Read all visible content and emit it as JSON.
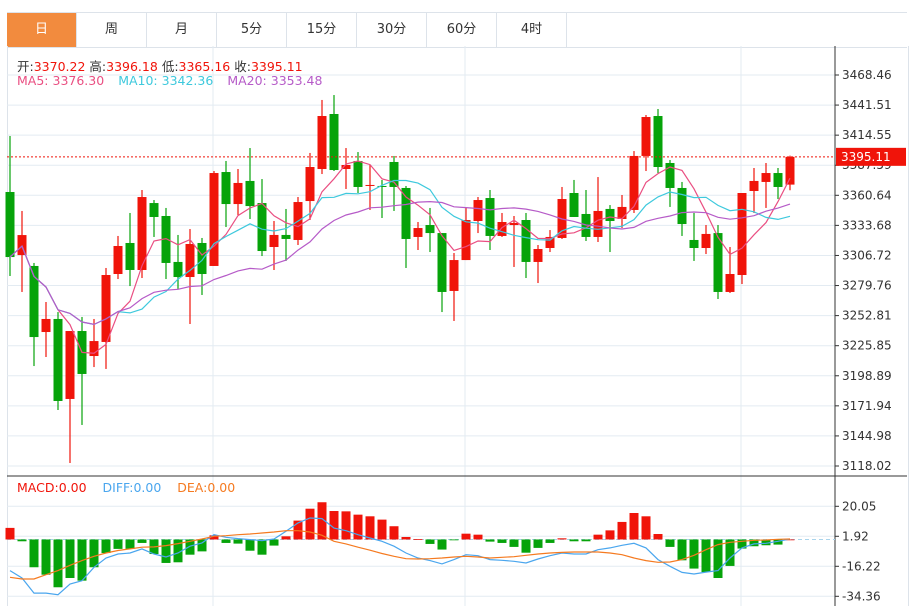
{
  "tabs": [
    {
      "label": "日",
      "active": true
    },
    {
      "label": "周"
    },
    {
      "label": "月"
    },
    {
      "label": "5分"
    },
    {
      "label": "15分"
    },
    {
      "label": "30分"
    },
    {
      "label": "60分"
    },
    {
      "label": "4时"
    }
  ],
  "ohlc_info": {
    "open_label": "开:",
    "open": "3370.22",
    "high_label": "高:",
    "high": "3396.18",
    "low_label": "低:",
    "low": "3365.16",
    "close_label": "收:",
    "close": "3395.11"
  },
  "ma_info": {
    "ma5_label": "MA5:",
    "ma5": "3376.30",
    "ma10_label": "MA10:",
    "ma10": "3342.36",
    "ma20_label": "MA20:",
    "ma20": "3353.48"
  },
  "macd_info": {
    "macd_label": "MACD:",
    "macd": "0.00",
    "diff_label": "DIFF:",
    "diff": "0.00",
    "dea_label": "DEA:",
    "dea": "0.00"
  },
  "current_price_label": "3395.11",
  "colors": {
    "up": "#f0140a",
    "down": "#06a30a",
    "ma5": "#ea4f82",
    "ma10": "#3ec9dd",
    "ma20": "#b65bc8",
    "diff": "#4aa6ee",
    "dea": "#f57a20",
    "active_tab": "#f28b3e"
  },
  "chart_data": [
    {
      "type": "candlestick",
      "title": "",
      "ylim": [
        3118.02,
        3468.46
      ],
      "y_ticks": [
        "3468.46",
        "3441.51",
        "3414.55",
        "3387.59",
        "3360.64",
        "3333.68",
        "3306.72",
        "3279.76",
        "3252.81",
        "3225.85",
        "3198.89",
        "3171.94",
        "3144.98",
        "3118.02"
      ],
      "grid": true,
      "current_price": 3395.11,
      "overlays": [
        "MA5",
        "MA10",
        "MA20"
      ],
      "ohlc": [
        [
          3363.6,
          3413.8,
          3288.3,
          3305.3
        ],
        [
          3307.1,
          3346.6,
          3274.0,
          3325.0
        ],
        [
          3297.3,
          3300.0,
          3207.6,
          3233.6
        ],
        [
          3238.1,
          3265.0,
          3215.7,
          3249.8
        ],
        [
          3249.8,
          3256.0,
          3168.2,
          3176.3
        ],
        [
          3178.1,
          3239.0,
          3120.7,
          3239.0
        ],
        [
          3239.0,
          3251.6,
          3154.8,
          3200.5
        ],
        [
          3216.6,
          3249.8,
          3206.7,
          3230.0
        ],
        [
          3229.2,
          3295.5,
          3205.0,
          3289.2
        ],
        [
          3290.1,
          3324.2,
          3285.6,
          3315.2
        ],
        [
          3317.9,
          3344.8,
          3279.3,
          3293.7
        ],
        [
          3293.7,
          3365.4,
          3286.5,
          3359.1
        ],
        [
          3353.7,
          3356.4,
          3323.3,
          3341.2
        ],
        [
          3342.1,
          3349.3,
          3285.6,
          3300.0
        ],
        [
          3300.9,
          3325.1,
          3276.7,
          3287.4
        ],
        [
          3287.4,
          3330.4,
          3245.3,
          3317.0
        ],
        [
          3317.9,
          3322.4,
          3271.3,
          3290.1
        ],
        [
          3297.3,
          3382.4,
          3297.3,
          3380.6
        ],
        [
          3381.5,
          3391.4,
          3332.2,
          3352.8
        ],
        [
          3352.8,
          3384.2,
          3343.0,
          3371.7
        ],
        [
          3373.5,
          3403.0,
          3339.4,
          3351.0
        ],
        [
          3353.7,
          3375.2,
          3306.2,
          3310.7
        ],
        [
          3314.3,
          3337.6,
          3293.7,
          3325.1
        ],
        [
          3325.1,
          3348.4,
          3301.8,
          3321.5
        ],
        [
          3320.6,
          3359.1,
          3316.1,
          3354.6
        ],
        [
          3355.5,
          3398.6,
          3338.5,
          3386.0
        ],
        [
          3384.2,
          3446.1,
          3379.7,
          3431.7
        ],
        [
          3433.5,
          3450.5,
          3382.4,
          3383.3
        ],
        [
          3384.2,
          3403.0,
          3366.3,
          3387.8
        ],
        [
          3391.4,
          3399.4,
          3362.7,
          3368.1
        ],
        [
          3369.0,
          3387.8,
          3347.5,
          3369.9
        ],
        [
          3369.0,
          3374.4,
          3340.3,
          3368.1
        ],
        [
          3390.5,
          3395.9,
          3346.6,
          3368.1
        ],
        [
          3367.2,
          3369.0,
          3295.5,
          3321.5
        ],
        [
          3323.3,
          3336.7,
          3311.6,
          3331.3
        ],
        [
          3334.0,
          3349.3,
          3309.8,
          3326.8
        ],
        [
          3326.8,
          3326.8,
          3256.0,
          3274.0
        ],
        [
          3274.9,
          3308.9,
          3248.0,
          3302.6
        ],
        [
          3302.6,
          3349.3,
          3302.6,
          3338.5
        ],
        [
          3337.6,
          3359.1,
          3326.8,
          3356.4
        ],
        [
          3358.2,
          3365.4,
          3311.6,
          3324.2
        ],
        [
          3324.2,
          3344.8,
          3323.3,
          3336.7
        ],
        [
          3334.0,
          3342.1,
          3296.4,
          3335.8
        ],
        [
          3338.5,
          3344.8,
          3286.5,
          3300.9
        ],
        [
          3300.9,
          3316.1,
          3282.0,
          3312.5
        ],
        [
          3313.4,
          3329.5,
          3309.8,
          3323.3
        ],
        [
          3322.4,
          3368.1,
          3321.5,
          3357.3
        ],
        [
          3362.7,
          3374.4,
          3341.2,
          3341.2
        ],
        [
          3343.9,
          3365.4,
          3319.7,
          3323.3
        ],
        [
          3323.3,
          3377.0,
          3318.8,
          3346.6
        ],
        [
          3348.4,
          3351.9,
          3309.8,
          3337.6
        ],
        [
          3339.4,
          3360.9,
          3331.3,
          3350.2
        ],
        [
          3347.5,
          3400.3,
          3344.8,
          3395.9
        ],
        [
          3395.9,
          3432.6,
          3382.4,
          3430.8
        ],
        [
          3431.7,
          3438.0,
          3380.6,
          3386.0
        ],
        [
          3389.6,
          3392.3,
          3350.2,
          3367.2
        ],
        [
          3367.2,
          3372.6,
          3324.2,
          3334.9
        ],
        [
          3320.6,
          3344.8,
          3301.8,
          3313.4
        ],
        [
          3313.4,
          3334.0,
          3308.0,
          3326.0
        ],
        [
          3326.8,
          3334.0,
          3267.7,
          3274.0
        ],
        [
          3274.0,
          3314.3,
          3273.1,
          3290.1
        ],
        [
          3289.2,
          3362.7,
          3281.1,
          3362.7
        ],
        [
          3364.5,
          3385.1,
          3344.8,
          3373.5
        ],
        [
          3372.6,
          3389.6,
          3349.3,
          3380.6
        ],
        [
          3380.6,
          3385.1,
          3357.3,
          3368.1
        ],
        [
          3370.22,
          3396.18,
          3365.16,
          3395.11
        ]
      ]
    },
    {
      "type": "bar",
      "title": "",
      "ylim": [
        -34.36,
        20.05
      ],
      "y_ticks": [
        "20.05",
        "1.92",
        "-16.22",
        "-34.36"
      ],
      "macd": [
        7.0,
        -1.1,
        -16.8,
        -21.3,
        -28.9,
        -23.3,
        -24.9,
        -16.8,
        -8.2,
        -5.7,
        -5.7,
        -2.1,
        -8.8,
        -14.2,
        -13.8,
        -9.2,
        -7.2,
        2.5,
        -2.1,
        -2.5,
        -6.8,
        -9.2,
        -3.7,
        1.9,
        11.4,
        18.6,
        22.5,
        17.2,
        17.0,
        15.0,
        14.0,
        12.0,
        8.0,
        1.5,
        0.2,
        -2.7,
        -6.1,
        -0.5,
        3.5,
        2.9,
        -1.3,
        -2.1,
        -4.5,
        -8.0,
        -5.1,
        -2.1,
        0.7,
        -1.1,
        -1.1,
        2.9,
        5.5,
        10.6,
        16.0,
        14.0,
        3.3,
        -4.5,
        -12.6,
        -17.6,
        -19.7,
        -23.3,
        -16.0,
        -5.5,
        -4.1,
        -3.5,
        -3.1,
        0.0
      ],
      "diff": [
        -18.8,
        -23.3,
        -32.4,
        -32.4,
        -33.4,
        -26.9,
        -24.9,
        -16.8,
        -11.2,
        -8.8,
        -8.2,
        -5.7,
        -8.8,
        -10.6,
        -8.2,
        -4.1,
        -2.1,
        2.9,
        1.3,
        0.5,
        -0.1,
        -0.7,
        0.3,
        5.0,
        10.0,
        13.0,
        12.6,
        6.9,
        5.3,
        2.9,
        0.9,
        -1.1,
        -4.1,
        -8.2,
        -11.2,
        -12.8,
        -14.8,
        -12.2,
        -9.2,
        -9.8,
        -12.2,
        -12.6,
        -13.2,
        -14.2,
        -11.8,
        -9.8,
        -8.2,
        -8.8,
        -8.8,
        -6.2,
        -5.1,
        -3.5,
        -2.3,
        -5.1,
        -12.2,
        -16.2,
        -19.9,
        -20.9,
        -19.7,
        -18.8,
        -11.2,
        -5.1,
        -2.7,
        -2.3,
        -1.1,
        0.3
      ],
      "dea": [
        -22.9,
        -23.9,
        -23.9,
        -21.3,
        -18.8,
        -15.6,
        -12.8,
        -10.2,
        -8.2,
        -6.7,
        -5.7,
        -4.7,
        -4.5,
        -3.7,
        -2.5,
        -1.1,
        0.3,
        1.9,
        2.3,
        2.9,
        3.3,
        3.9,
        4.5,
        5.3,
        5.3,
        4.5,
        2.5,
        -1.1,
        -2.7,
        -4.7,
        -6.5,
        -8.5,
        -10.2,
        -11.6,
        -11.8,
        -11.6,
        -11.2,
        -10.6,
        -10.2,
        -10.6,
        -11.2,
        -10.8,
        -10.4,
        -9.6,
        -8.8,
        -8.2,
        -7.8,
        -7.6,
        -7.6,
        -7.6,
        -8.2,
        -9.2,
        -11.2,
        -12.8,
        -13.8,
        -13.6,
        -12.2,
        -9.6,
        -6.2,
        -3.1,
        -1.7,
        -1.1,
        -0.5,
        -0.3,
        0.1,
        0.3
      ]
    }
  ]
}
